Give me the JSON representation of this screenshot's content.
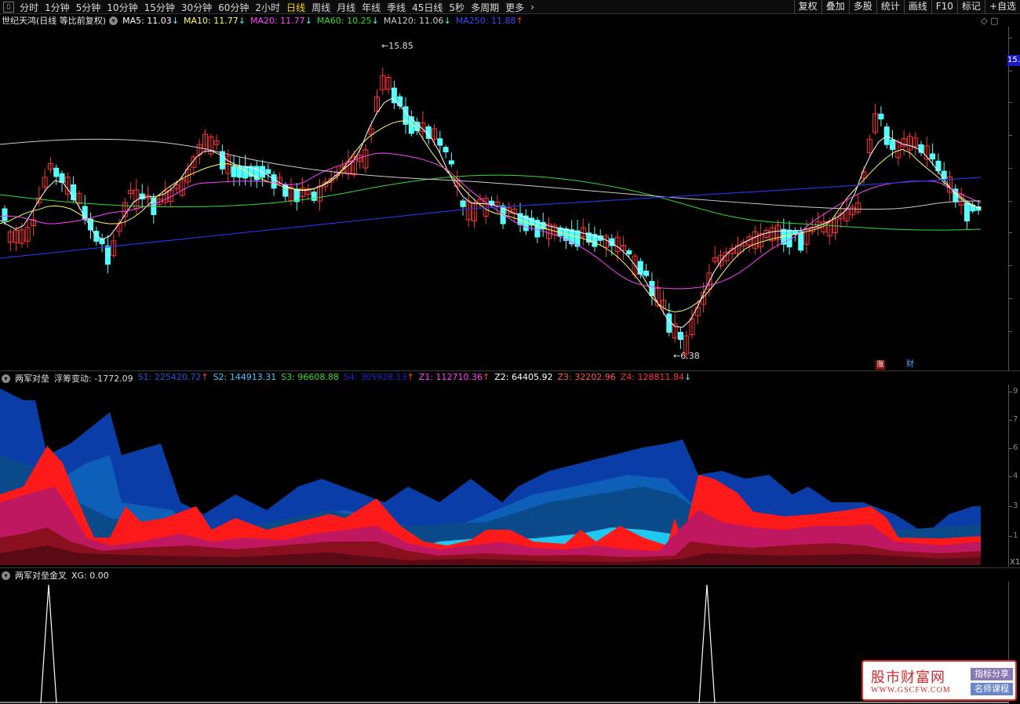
{
  "toolbar": {
    "periods": [
      "分时",
      "1分钟",
      "5分钟",
      "10分钟",
      "15分钟",
      "30分钟",
      "60分钟",
      "2小时",
      "日线",
      "周线",
      "月线",
      "年线",
      "季线",
      "45日线",
      "5秒",
      "多周期",
      "更多"
    ],
    "active_period": "日线",
    "right_buttons": [
      "复权",
      "叠加",
      "多股",
      "统计",
      "画线",
      "F10",
      "标记",
      "+自选"
    ]
  },
  "main_panel": {
    "stock_title": "世纪天鸿(日线 等比前复权)",
    "ma_legend": [
      {
        "text": "MA5: 11.03",
        "arrow": "↓",
        "color": "#ffffff"
      },
      {
        "text": "MA10: 11.77",
        "arrow": "↓",
        "color": "#ffff66"
      },
      {
        "text": "MA20: 11.77",
        "arrow": "↓",
        "color": "#ff44ff"
      },
      {
        "text": "MA60: 10.25",
        "arrow": "↓",
        "color": "#33dd33"
      },
      {
        "text": "MA120: 11.06",
        "arrow": "↓",
        "color": "#cccccc"
      },
      {
        "text": "MA250: 11.88",
        "arrow": "↑",
        "color": "#4444ff"
      }
    ],
    "high_label": "15.85",
    "low_label": "6.38",
    "price_tag": "15.",
    "event_markers": [
      "涨",
      "财"
    ]
  },
  "indicator_panel": {
    "title": "两军对垒",
    "fields": [
      {
        "text": "浮筹变动: -1772.09",
        "color": "#dddddd"
      },
      {
        "text": "S1: 225420.72",
        "arrow": "↑",
        "color": "#2255dd"
      },
      {
        "text": "S2: 144913.31",
        "color": "#33ccff"
      },
      {
        "text": "S3: 96608.88",
        "color": "#33dd33"
      },
      {
        "text": "S4: 305928.13",
        "arrow": "↑",
        "color": "#2222cc"
      },
      {
        "text": "Z1: 112710.36",
        "arrow": "↑",
        "color": "#ff44ff"
      },
      {
        "text": "Z2: 64405.92",
        "color": "#ffffff"
      },
      {
        "text": "Z3: 32202.96",
        "color": "#ff5555"
      },
      {
        "text": "Z4: 128811.84",
        "arrow": "↓",
        "color": "#ff3333"
      }
    ],
    "scale_labels": [
      "9",
      "7",
      "6",
      "4",
      "3",
      "1"
    ],
    "corner_label": "X1"
  },
  "signal_panel": {
    "title": "两军对垒金叉",
    "value_text": "XG: 0.00"
  },
  "watermark": {
    "title": "股市财富网",
    "url": "WWW.GSCFW.COM",
    "tag1": "指标分享",
    "tag2": "名师课程"
  },
  "colors": {
    "up_candle": "#ff3232",
    "down_candle": "#54ffff",
    "ma5": "#ffffff",
    "ma10": "#ffff66",
    "ma20": "#ff44ff",
    "ma60": "#33dd33",
    "ma120": "#cccccc",
    "ma250": "#2233dd"
  }
}
